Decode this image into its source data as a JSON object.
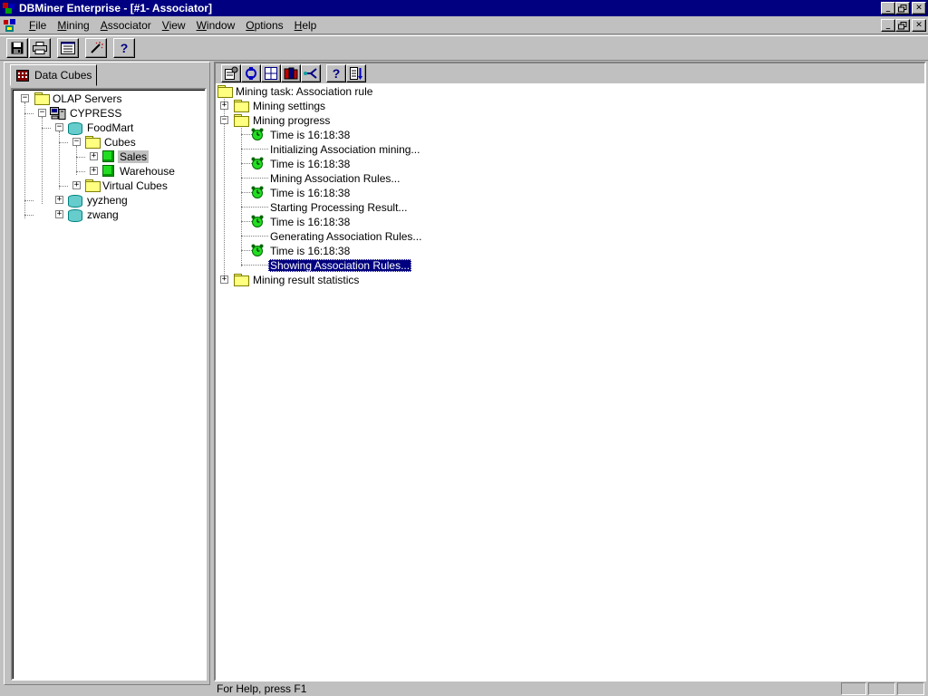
{
  "window": {
    "title": "DBMiner Enterprise - [#1- Associator]"
  },
  "menu": {
    "items": [
      {
        "label": "File",
        "key": "F",
        "rest": "ile"
      },
      {
        "label": "Mining",
        "key": "M",
        "rest": "ining"
      },
      {
        "label": "Associator",
        "key": "A",
        "rest": "ssociator"
      },
      {
        "label": "View",
        "key": "V",
        "rest": "iew"
      },
      {
        "label": "Window",
        "key": "W",
        "rest": "indow"
      },
      {
        "label": "Options",
        "key": "O",
        "rest": "ptions"
      },
      {
        "label": "Help",
        "key": "H",
        "rest": "elp"
      }
    ]
  },
  "toolbar": {
    "buttons": [
      "save-icon",
      "print-icon",
      "list-icon",
      "magic-wand-icon",
      "help-icon"
    ],
    "help_glyph": "?"
  },
  "left_panel": {
    "tab_label": "Data Cubes",
    "tree": {
      "olap_servers": "OLAP Servers",
      "cypress": "CYPRESS",
      "foodmart": "FoodMart",
      "cubes": "Cubes",
      "sales": "Sales",
      "warehouse": "Warehouse",
      "virtual_cubes": "Virtual Cubes",
      "yyzheng": "yyzheng",
      "zwang": "zwang"
    }
  },
  "right_toolbar": {
    "buttons": [
      "properties-icon",
      "cycle-icon",
      "grid-icon",
      "books-icon",
      "branch-icon",
      "query-icon",
      "sort-icon"
    ],
    "query_glyph": "?"
  },
  "task_tree": {
    "root": "Mining task: Association rule",
    "settings": "Mining settings",
    "progress": "Mining progress",
    "events": [
      {
        "time": "Time is 16:18:38",
        "message": "Initializing Association mining..."
      },
      {
        "time": "Time is 16:18:38",
        "message": "Mining Association Rules..."
      },
      {
        "time": "Time is 16:18:38",
        "message": "Starting Processing Result..."
      },
      {
        "time": "Time is 16:18:38",
        "message": "Generating Association Rules..."
      },
      {
        "time": "Time is 16:18:38",
        "message": "Showing Association Rules..."
      }
    ],
    "statistics": "Mining result statistics"
  },
  "status_bar": {
    "text": "For Help, press F1"
  },
  "colors": {
    "title_bar": "#000080",
    "face": "#c0c0c0",
    "selection": "#000080",
    "cube": "#22dd22",
    "folder": "#ffff80"
  }
}
